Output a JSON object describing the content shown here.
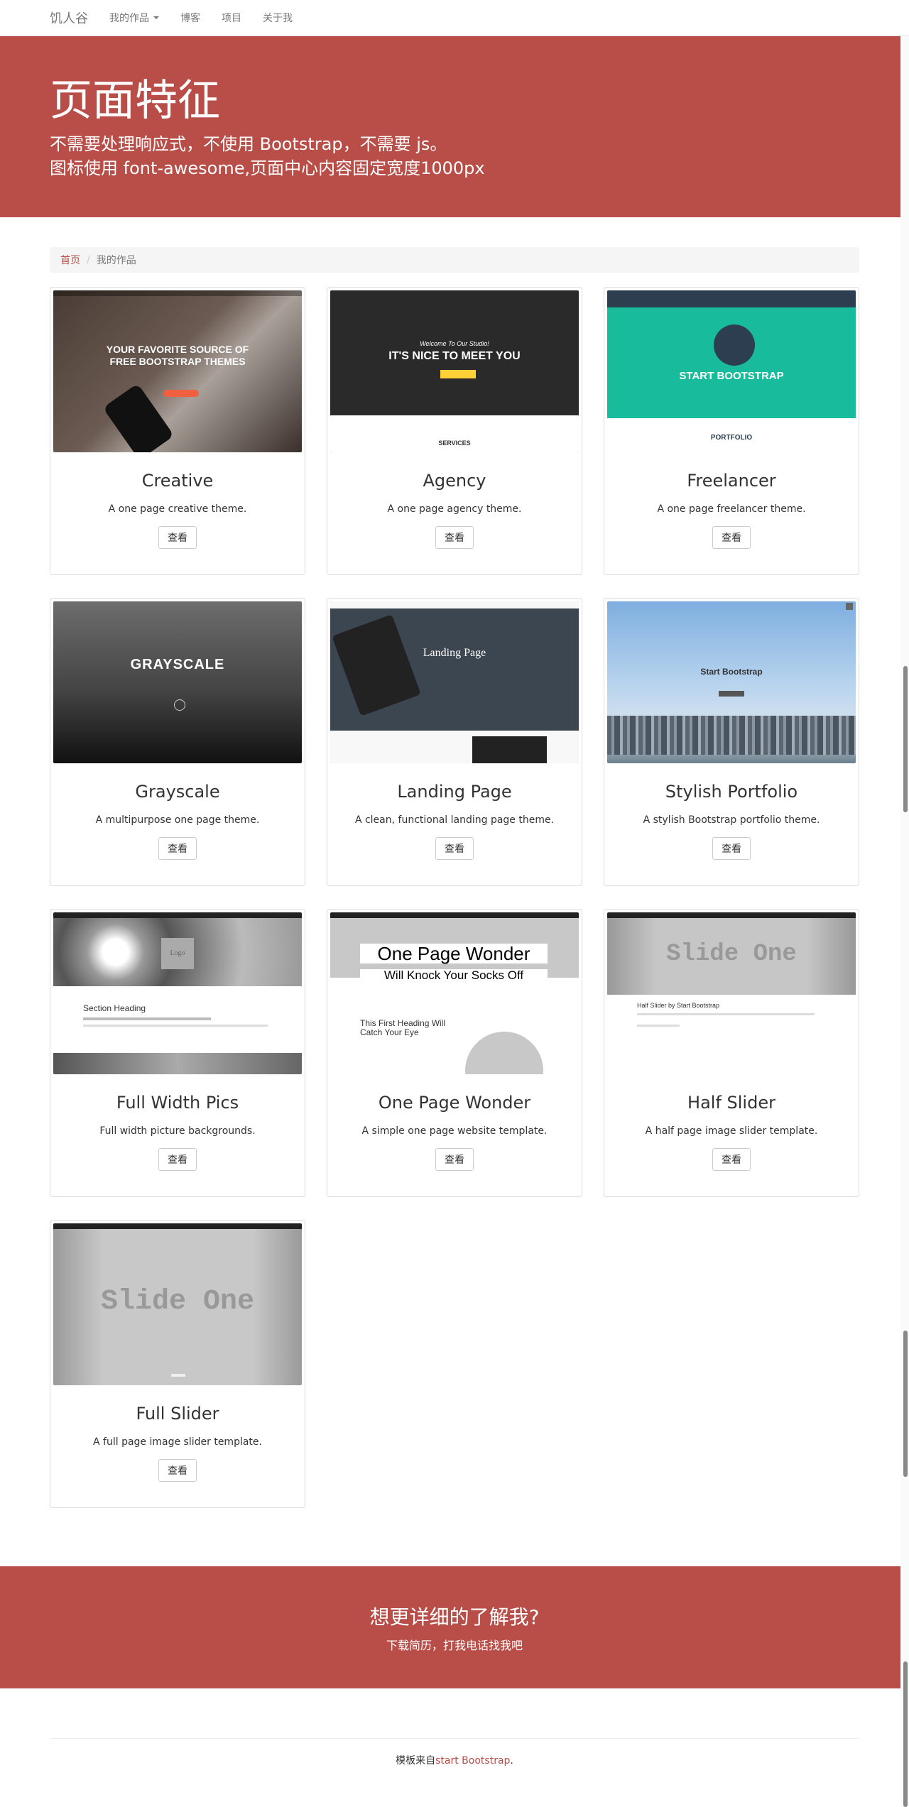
{
  "navbar": {
    "brand": "饥人谷",
    "items": [
      {
        "label": "我的作品"
      },
      {
        "label": "博客"
      },
      {
        "label": "项目"
      },
      {
        "label": "关于我"
      }
    ]
  },
  "hero": {
    "title": "页面特征",
    "line1": "不需要处理响应式，不使用 Bootstrap，不需要 js。",
    "line2": "图标使用 font-awesome,页面中心内容固定宽度1000px"
  },
  "breadcrumb": {
    "home": "首页",
    "current": "我的作品"
  },
  "cards": [
    {
      "title": "Creative",
      "desc": "A one page creative theme.",
      "button": "查看"
    },
    {
      "title": "Agency",
      "desc": "A one page agency theme.",
      "button": "查看"
    },
    {
      "title": "Freelancer",
      "desc": "A one page freelancer theme.",
      "button": "查看"
    },
    {
      "title": "Grayscale",
      "desc": "A multipurpose one page theme.",
      "button": "查看"
    },
    {
      "title": "Landing Page",
      "desc": "A clean, functional landing page theme.",
      "button": "查看"
    },
    {
      "title": "Stylish Portfolio",
      "desc": "A stylish Bootstrap portfolio theme.",
      "button": "查看"
    },
    {
      "title": "Full Width Pics",
      "desc": "Full width picture backgrounds.",
      "button": "查看"
    },
    {
      "title": "One Page Wonder",
      "desc": "A simple one page website template.",
      "button": "查看"
    },
    {
      "title": "Half Slider",
      "desc": "A half page image slider template.",
      "button": "查看"
    },
    {
      "title": "Full Slider",
      "desc": "A full page image slider template.",
      "button": "查看"
    }
  ],
  "thumbs": {
    "creative": {
      "headline": "YOUR FAVORITE SOURCE OF FREE BOOTSTRAP THEMES"
    },
    "agency": {
      "welcome": "Welcome To Our Studio!",
      "headline": "IT'S NICE TO MEET YOU",
      "section": "SERVICES"
    },
    "freelancer": {
      "headline": "START BOOTSTRAP",
      "section": "PORTFOLIO"
    },
    "grayscale": {
      "headline": "GRAYSCALE"
    },
    "landing": {
      "headline": "Landing Page"
    },
    "stylish": {
      "headline": "Start Bootstrap"
    },
    "fullwidth": {
      "heading": "Section Heading",
      "logo": "Logo"
    },
    "onepage": {
      "line1": "One Page Wonder",
      "line2": "Will Knock Your Socks Off",
      "heading": "This First Heading Will Catch Your Eye"
    },
    "half": {
      "slide": "Slide One",
      "caption": "Half Slider by Start Bootstrap"
    },
    "fullslider": {
      "slide": "Slide One"
    }
  },
  "cta": {
    "title": "想更详细的了解我?",
    "subtitle": "下载简历，打我电话找我吧"
  },
  "footer": {
    "prefix": "模板来自",
    "link": "start Bootstrap",
    "suffix": "."
  },
  "colors": {
    "accent": "#b94d47",
    "freelancer_teal": "#18bc9c"
  }
}
